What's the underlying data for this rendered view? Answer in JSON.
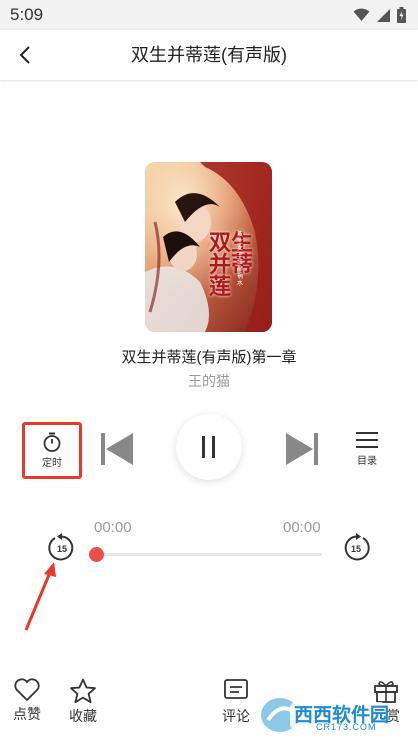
{
  "status": {
    "time": "5:09"
  },
  "header": {
    "title": "双生并蒂莲(有声版)"
  },
  "cover": {
    "art_text": "双生并蒂莲",
    "art_tag": "双生女王 红颜祸水"
  },
  "track": {
    "title": "双生并蒂莲(有声版)第一章",
    "author": "王的猫"
  },
  "controls": {
    "timer_label": "定时",
    "catalog_label": "目录",
    "rewind_seconds": "15",
    "forward_seconds": "15"
  },
  "progress": {
    "current": "00:00",
    "total": "00:00",
    "fraction": 0.0
  },
  "bottom": {
    "like_label": "点赞",
    "favorite_label": "收藏",
    "comment_label": "评论",
    "reward_label": "打赏"
  },
  "watermark": {
    "text": "西西软件园",
    "sub": "CR173.COM"
  },
  "colors": {
    "accent": "#e8514a",
    "highlight_border": "#e8392d",
    "muted_text": "#9a9a9a"
  }
}
